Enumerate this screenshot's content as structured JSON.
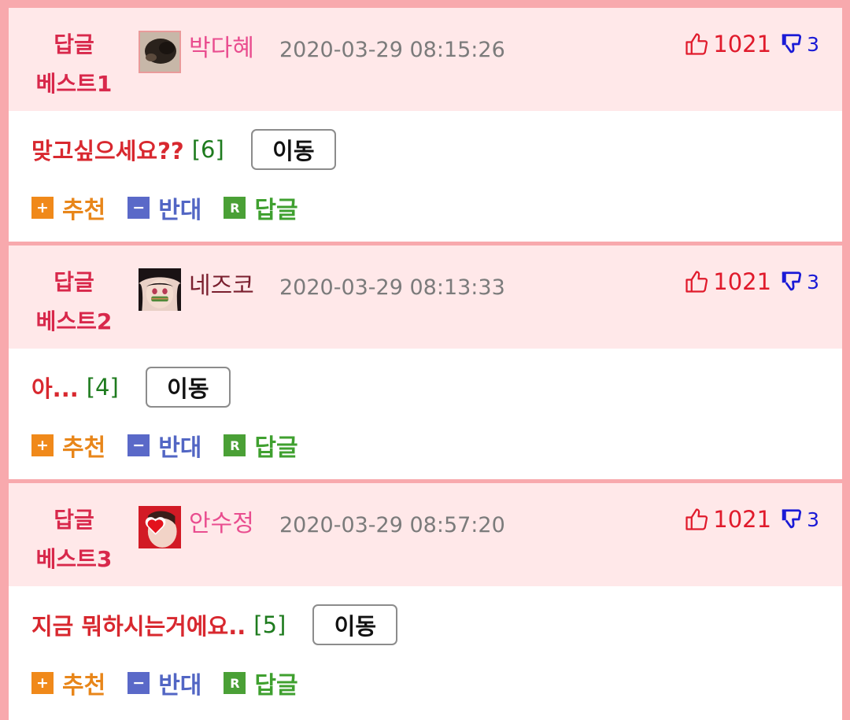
{
  "colors": {
    "pink_nick": "#e94d8f",
    "maroon_nick": "#7a1f2e"
  },
  "posts": [
    {
      "rank_line1": "답글",
      "rank_line2": "베스트1",
      "nickname": "박다혜",
      "nick_color": "#e94d8f",
      "date": "2020-03-29 08:15:26",
      "up": "1021",
      "down": "3",
      "title": "맞고싶으세요??",
      "replies": "[6]",
      "avatar": "dark-fur-avatar"
    },
    {
      "rank_line1": "답글",
      "rank_line2": "베스트2",
      "nickname": "네즈코",
      "nick_color": "#7a1f2e",
      "date": "2020-03-29 08:13:33",
      "up": "1021",
      "down": "3",
      "title": "아...",
      "replies": "[4]",
      "avatar": "anime-girl-avatar"
    },
    {
      "rank_line1": "답글",
      "rank_line2": "베스트3",
      "nickname": "안수정",
      "nick_color": "#e94d8f",
      "date": "2020-03-29 08:57:20",
      "up": "1021",
      "down": "3",
      "title": "지금 뭐하시는거에요..",
      "replies": "[5]",
      "avatar": "heart-photo-avatar"
    }
  ],
  "labels": {
    "move": "이동",
    "recommend": "추천",
    "oppose": "반대",
    "reply": "답글",
    "recommend_icon": "+",
    "oppose_icon": "−",
    "reply_icon": "R"
  },
  "icons": {
    "up": "thumbs-up-icon",
    "down": "thumbs-down-icon"
  }
}
